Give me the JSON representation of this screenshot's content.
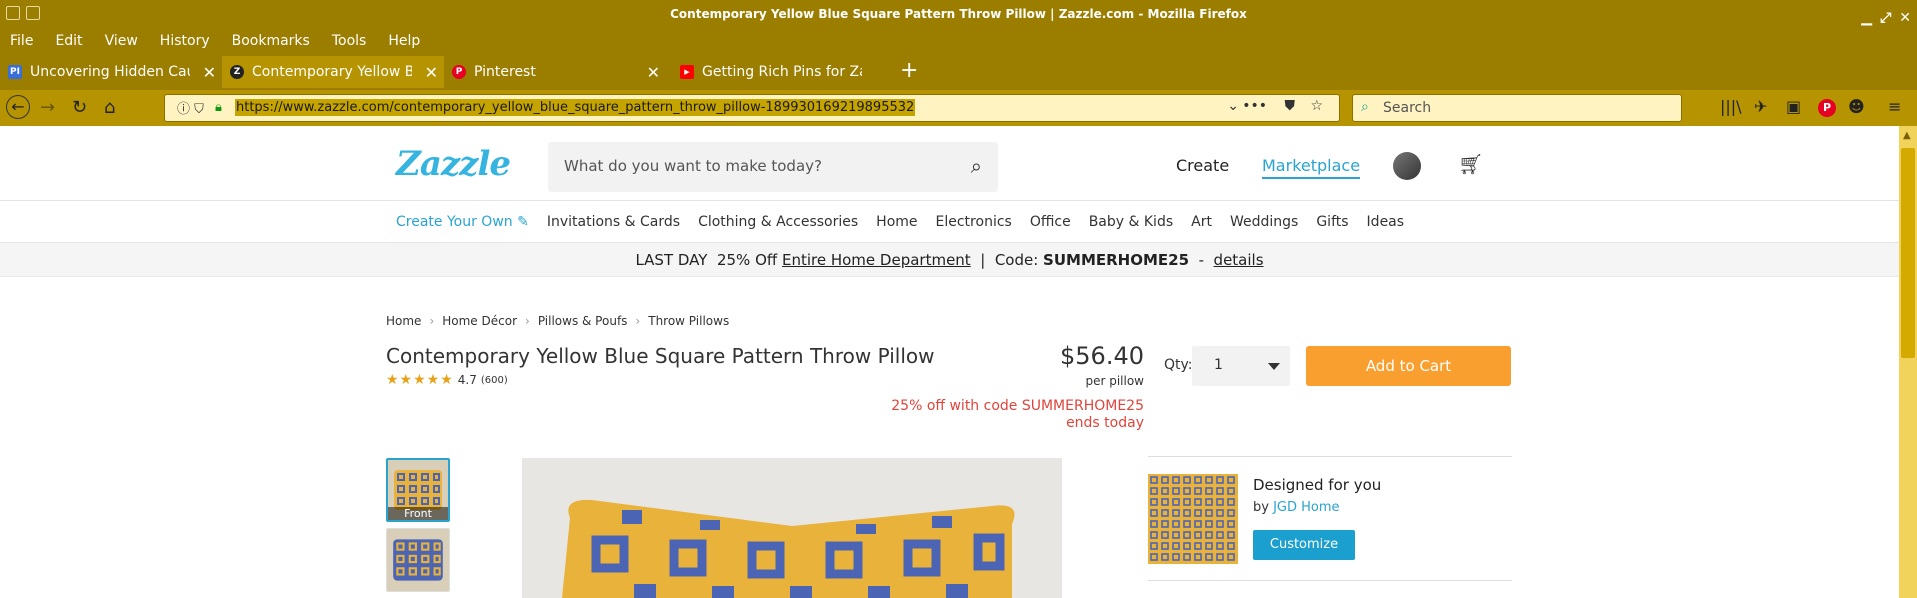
{
  "window": {
    "title": "Contemporary Yellow Blue Square Pattern Throw Pillow | Zazzle.com - Mozilla Firefox"
  },
  "menu": [
    "File",
    "Edit",
    "View",
    "History",
    "Bookmarks",
    "Tools",
    "Help"
  ],
  "tabs": [
    {
      "label": "Uncovering Hidden Caus",
      "favicon": "PI",
      "color": "#3a6fd8"
    },
    {
      "label": "Contemporary Yellow Blu",
      "favicon": "Z",
      "color": "#222"
    },
    {
      "label": "Pinterest",
      "favicon": "P",
      "color": "#e60023"
    },
    {
      "label": "Getting Rich Pins for Zaz",
      "favicon": "▶",
      "color": "#ff0000"
    }
  ],
  "nav": {
    "url": "https://www.zazzle.com/contemporary_yellow_blue_square_pattern_throw_pillow-189930169219895532",
    "search_placeholder": "Search"
  },
  "site": {
    "logo": "Zazzle",
    "search_placeholder": "What do you want to make today?",
    "create": "Create",
    "marketplace": "Marketplace"
  },
  "categories": [
    "Create Your Own ✎",
    "Invitations & Cards",
    "Clothing & Accessories",
    "Home",
    "Electronics",
    "Office",
    "Baby & Kids",
    "Art",
    "Weddings",
    "Gifts",
    "Ideas"
  ],
  "promo": {
    "prefix": "LAST DAY  25% Off ",
    "link": "Entire Home Department",
    "mid": "  |  Code: ",
    "code": "SUMMERHOME25",
    "dash": "  -  ",
    "details": "details"
  },
  "breadcrumb": [
    "Home",
    "Home Décor",
    "Pillows & Poufs",
    "Throw Pillows"
  ],
  "product": {
    "title": "Contemporary Yellow Blue Square Pattern Throw Pillow",
    "stars": "★★★★★",
    "rating": "4.7",
    "reviews": "(600)",
    "price": "$56.40",
    "unit": "per pillow",
    "discount_line1": "25% off with code SUMMERHOME25",
    "discount_line2": "ends today",
    "qty_label": "Qty:",
    "qty_value": "1",
    "add_to_cart": "Add to Cart",
    "thumb_front": "Front"
  },
  "designer": {
    "title": "Designed for you",
    "by": "by ",
    "name": "JGD Home",
    "customize": "Customize"
  },
  "colors": {
    "titlebar": "#9b7d00",
    "accent": "#2aa4cf",
    "cta": "#f99f2f",
    "pillow_yellow": "#e9b23a",
    "pillow_blue": "#4b65b4"
  }
}
